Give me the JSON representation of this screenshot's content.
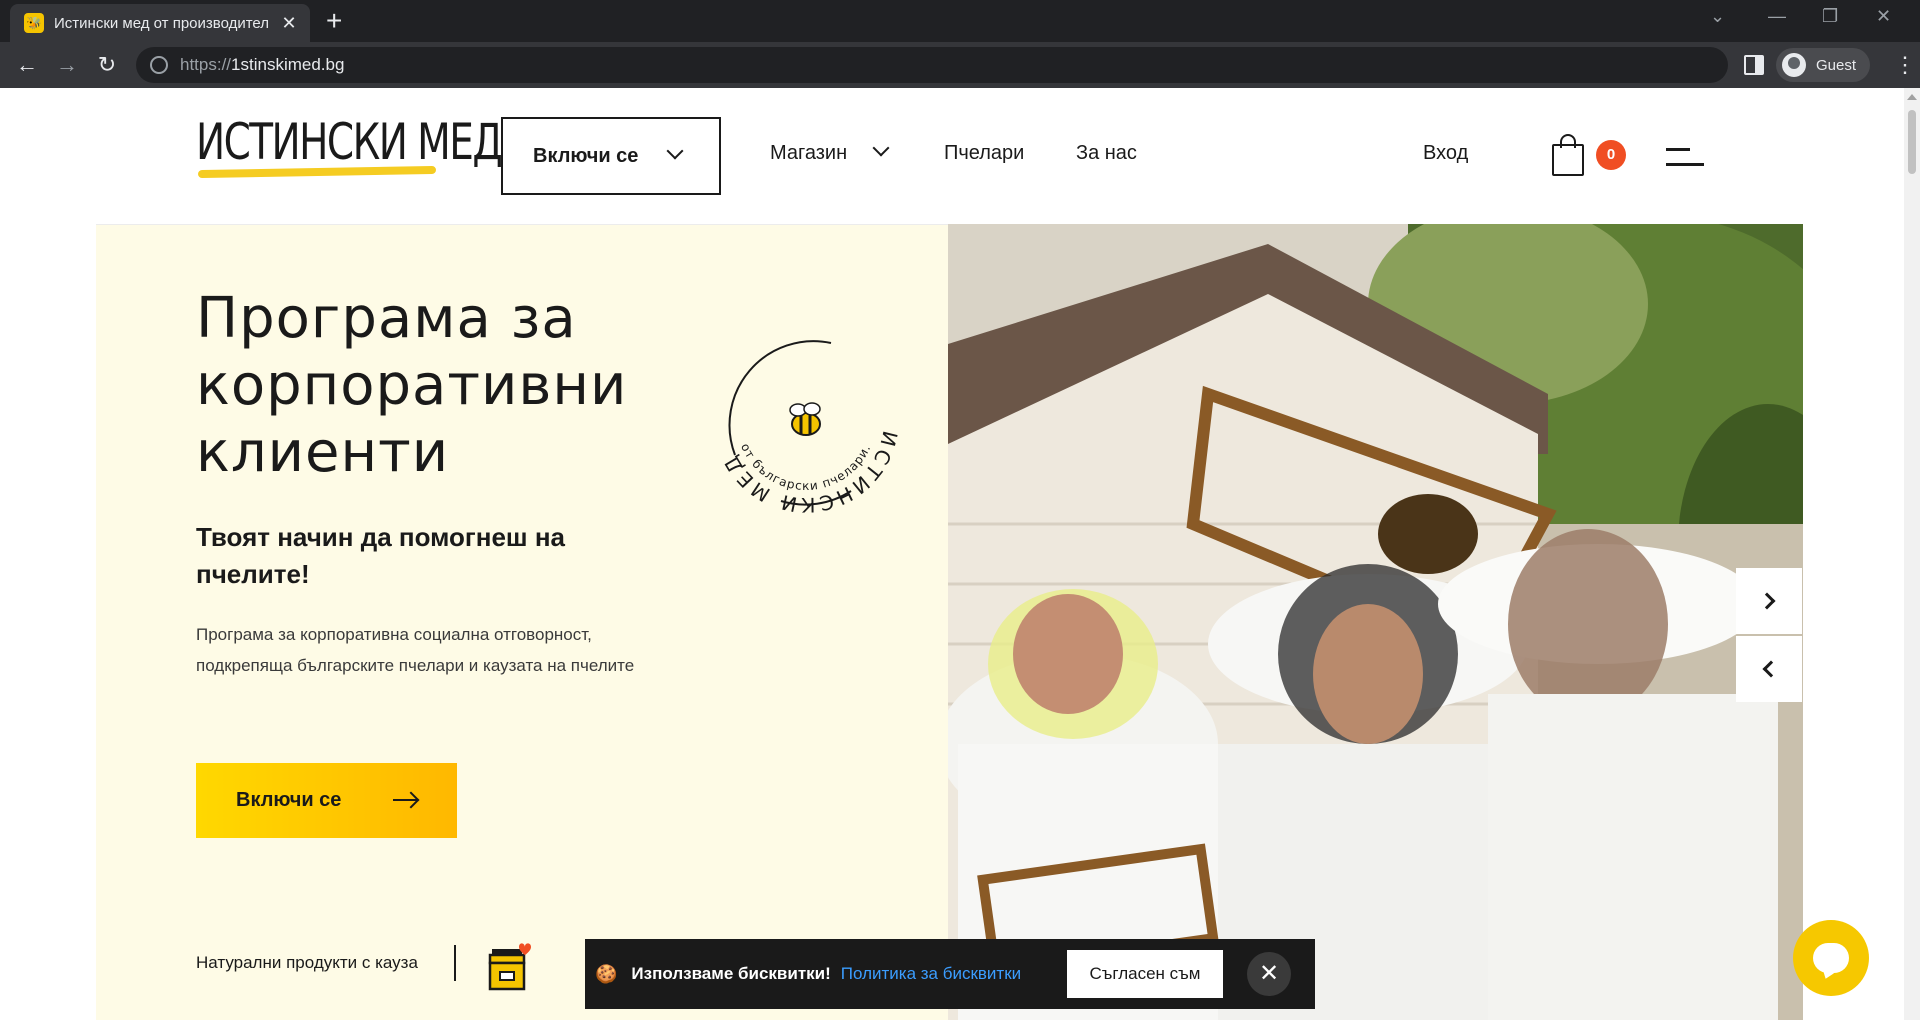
{
  "browser": {
    "tab_title": "Истински мед от производител",
    "tab_close": "✕",
    "new_tab": "+",
    "url_prefix": "https://",
    "url_host": "1stinskimed.bg",
    "profile_label": "Guest",
    "win_minimize": "—",
    "win_restore": "❐",
    "win_close": "✕",
    "tabs_dropdown": "⌄",
    "menu": "⋮"
  },
  "header": {
    "logo": "ИСТИНСКИ МЕД",
    "join_label": "Включи се",
    "shop_label": "Магазин",
    "beekeepers_label": "Пчелари",
    "about_label": "За нас",
    "login_label": "Вход",
    "cart_count": "0"
  },
  "hero": {
    "title_line1": "Програма за",
    "title_line2": "корпоративни",
    "title_line3": "клиенти",
    "subtitle": "Твоят начин да помогнеш на пчелите!",
    "description": "Програма за корпоративна социална отговорност, подкрепяща българските пчелари и каузата на пчелите",
    "cta_label": "Включи се",
    "badge_outer": "ИСТИНСКИ МЕД",
    "badge_inner": "от български пчелари.",
    "tagline": "Натурални продукти с кауза"
  },
  "cookie": {
    "emoji": "🍪",
    "text": "Използваме бисквитки!",
    "policy_link": "Политика за бисквитки",
    "accept_label": "Съгласен съм",
    "close": "✕"
  },
  "colors": {
    "accent": "#FFD200",
    "hero_bg": "#FEFBE6",
    "badge_red": "#F04E23",
    "link_blue": "#3B9DFF"
  }
}
